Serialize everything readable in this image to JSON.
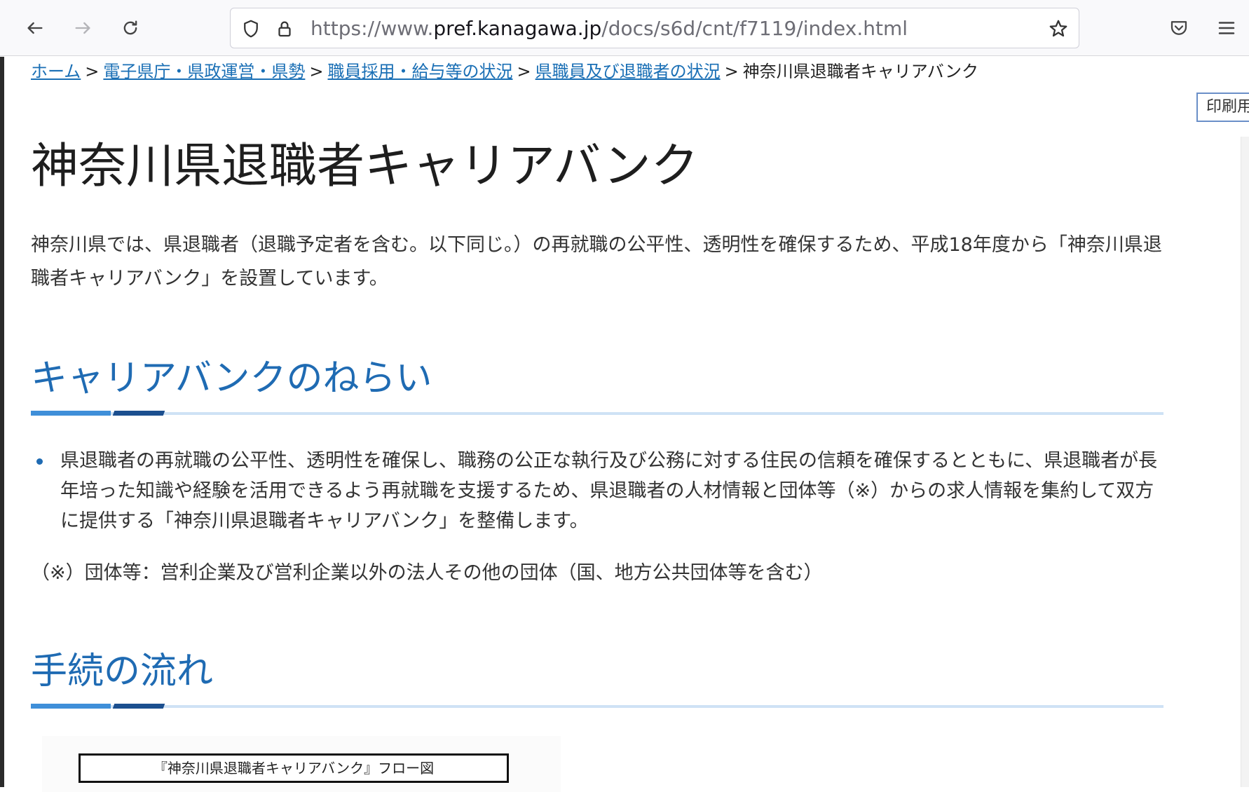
{
  "browser": {
    "url_prefix": "https://www.",
    "url_host": "pref.kanagawa.jp",
    "url_path": "/docs/s6d/cnt/f7119/index.html",
    "icons": [
      "back-arrow-icon",
      "forward-arrow-icon",
      "reload-icon",
      "shield-icon",
      "lock-icon",
      "star-icon",
      "pocket-icon",
      "hamburger-menu-icon"
    ]
  },
  "breadcrumb": {
    "items": [
      "ホーム",
      "電子県庁・県政運営・県勢",
      "職員採用・給与等の状況",
      "県職員及び退職者の状況"
    ],
    "separator": ">",
    "current": "神奈川県退職者キャリアバンク"
  },
  "print_button": "印刷用",
  "page": {
    "title": "神奈川県退職者キャリアバンク",
    "intro": "神奈川県では、県退職者（退職予定者を含む。以下同じ。）の再就職の公平性、透明性を確保するため、平成18年度から「神奈川県退職者キャリアバンク」を設置しています。"
  },
  "sections": {
    "aim": {
      "heading": "キャリアバンクのねらい",
      "bullet": "県退職者の再就職の公平性、透明性を確保し、職務の公正な執行及び公務に対する住民の信頼を確保するとともに、県退職者が長年培った知識や経験を活用できるよう再就職を支援するため、県退職者の人材情報と団体等（※）からの求人情報を集約して双方に提供する「神奈川県退職者キャリアバンク」を整備します。",
      "note": "（※）団体等：営利企業及び営利企業以外の法人その他の団体（国、地方公共団体等を含む）"
    },
    "flow": {
      "heading": "手続の流れ",
      "figure_title": "『神奈川県退職者キャリアバンク』フロー図"
    }
  },
  "colors": {
    "link": "#1a6fb5",
    "heading": "#1f6bb3",
    "rule_light": "#cfe2f5",
    "rule_mid": "#3f8fd9",
    "rule_dark": "#1b4f8f"
  }
}
